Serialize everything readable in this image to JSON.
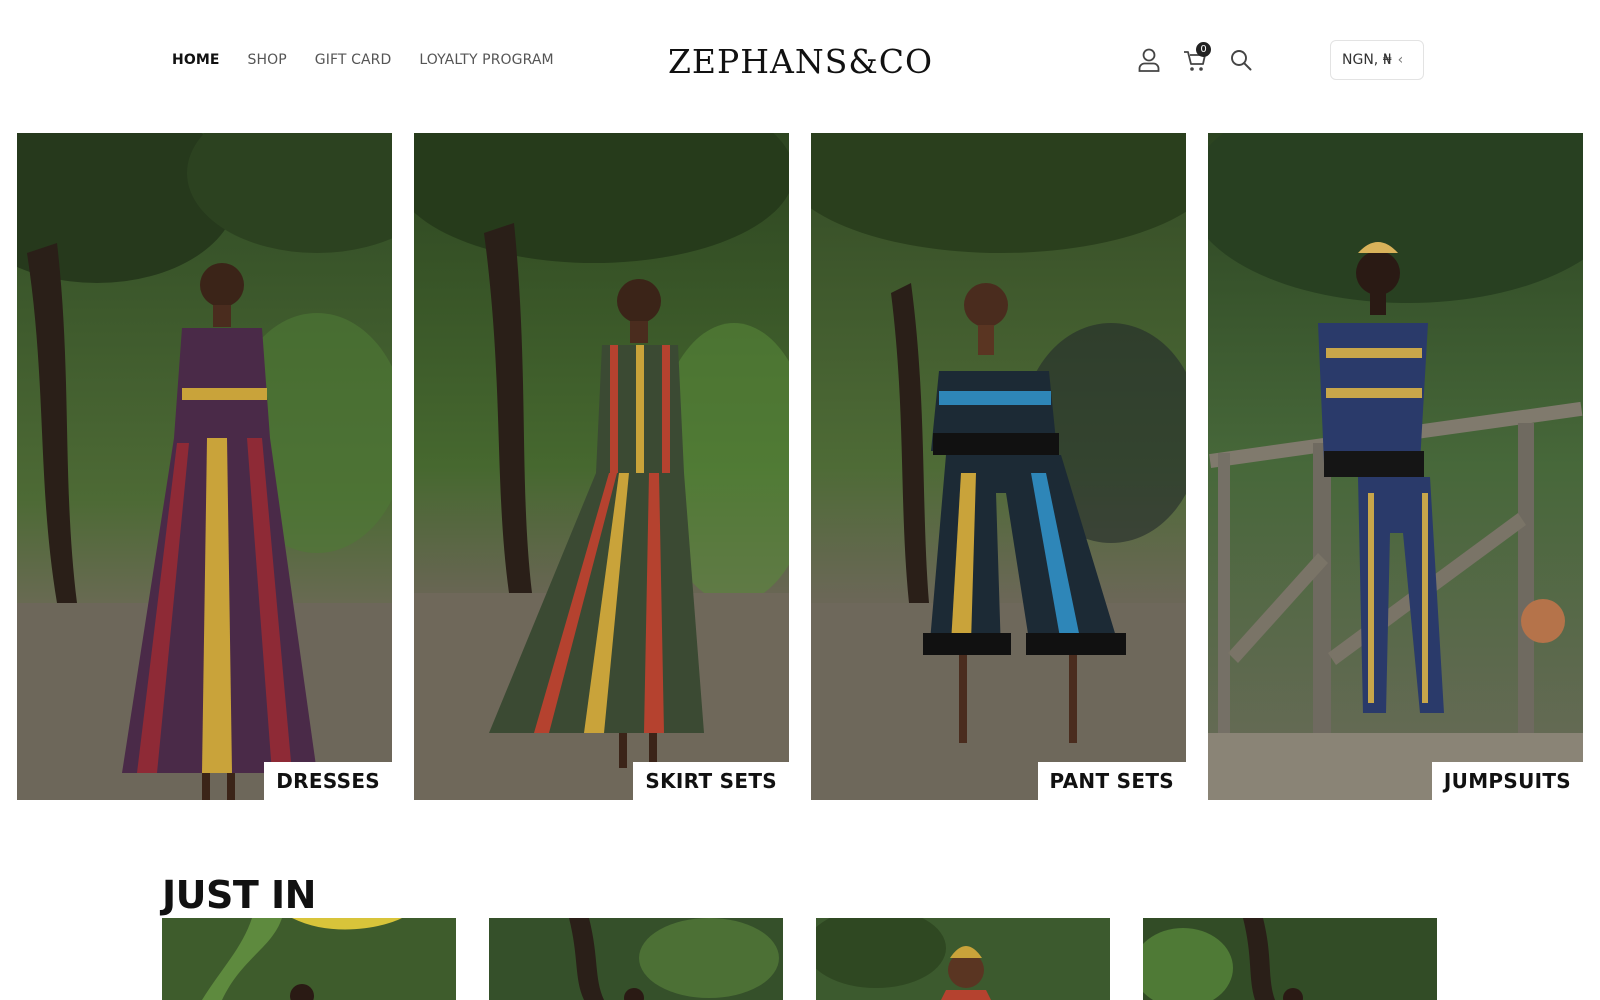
{
  "header": {
    "nav": [
      "HOME",
      "SHOP",
      "GIFT CARD",
      "LOYALTY PROGRAM"
    ],
    "active_nav": "HOME",
    "logo": "ZEPHANS&CO",
    "cart_count": "0",
    "currency": "NGN, ₦",
    "icons": [
      "user-icon",
      "cart-icon",
      "search-icon",
      "chevron-icon"
    ]
  },
  "categories": [
    {
      "label": "DRESSES",
      "colors": {
        "dress": "#4a2a48",
        "accent": "#c9a33a"
      }
    },
    {
      "label": "SKIRT SETS",
      "colors": {
        "dress": "#3b4a33",
        "accent": "#b5422f"
      }
    },
    {
      "label": "PANT SETS",
      "colors": {
        "dress": "#1c2a35",
        "accent": "#2e86b8"
      }
    },
    {
      "label": "JUMPSUITS",
      "colors": {
        "dress": "#2a3a6a",
        "accent": "#c8a64a"
      }
    }
  ],
  "just_in": {
    "title": "JUST IN",
    "items": [
      "product-1",
      "product-2",
      "product-3",
      "product-4"
    ]
  }
}
